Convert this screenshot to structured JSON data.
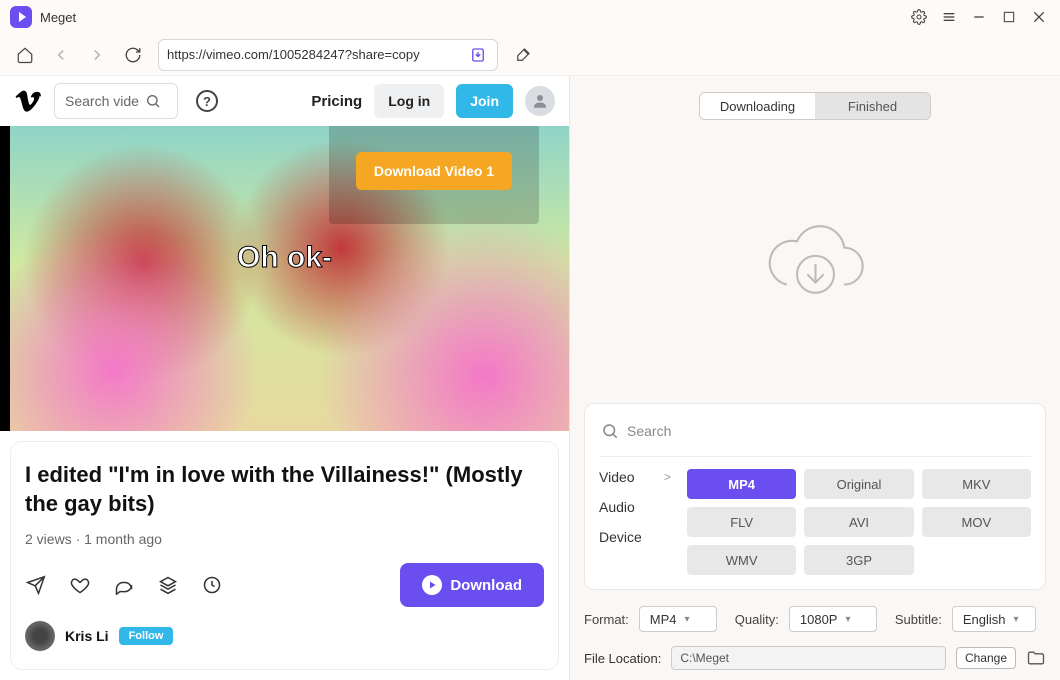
{
  "app": {
    "title": "Meget"
  },
  "toolbar": {
    "url": "https://vimeo.com/1005284247?share=copy"
  },
  "vimeo": {
    "search_placeholder": "Search vide",
    "pricing": "Pricing",
    "login": "Log in",
    "join": "Join"
  },
  "overlay": {
    "download_video_label": "Download Video 1"
  },
  "video": {
    "caption": "Oh ok-",
    "title": "I edited \"I'm in love with the Villainess!\" (Mostly the gay bits)",
    "meta": "2 views · 1 month ago",
    "download_btn": "Download",
    "uploader": "Kris Li",
    "follow": "Follow"
  },
  "right": {
    "tab_downloading": "Downloading",
    "tab_finished": "Finished",
    "search_placeholder": "Search",
    "cat_video": "Video",
    "cat_audio": "Audio",
    "cat_device": "Device",
    "formats": {
      "mp4": "MP4",
      "original": "Original",
      "mkv": "MKV",
      "flv": "FLV",
      "avi": "AVI",
      "mov": "MOV",
      "wmv": "WMV",
      "threegp": "3GP"
    },
    "opt_format_label": "Format:",
    "opt_format_value": "MP4",
    "opt_quality_label": "Quality:",
    "opt_quality_value": "1080P",
    "opt_subtitle_label": "Subtitle:",
    "opt_subtitle_value": "English",
    "location_label": "File Location:",
    "location_value": "C:\\Meget",
    "change_btn": "Change"
  }
}
